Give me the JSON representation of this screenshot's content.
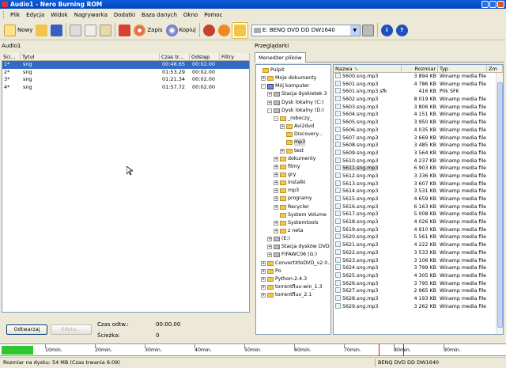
{
  "window": {
    "title": "Audio1 - Nero Burning ROM"
  },
  "menu": [
    "Plik",
    "Edycja",
    "Widok",
    "Nagrywarka",
    "Dodatki",
    "Baza danych",
    "Okno",
    "Pomoc"
  ],
  "toolbar": {
    "new_label": "Nowy",
    "burn_label": "Zapis",
    "copy_label": "Kopiuj",
    "drive_label": "E: BENQ DVD DD DW1640"
  },
  "left": {
    "title": "Audio1",
    "columns": [
      "Ści...",
      "Tytuł",
      "Czas tr...",
      "Odstęp",
      "Filtry"
    ],
    "tracks": [
      {
        "num": "1*",
        "title": "sng",
        "time": "00:48.65",
        "gap": "00:02.00"
      },
      {
        "num": "2*",
        "title": "sng",
        "time": "01:53.29",
        "gap": "00:02.00"
      },
      {
        "num": "3*",
        "title": "sng",
        "time": "01:21.34",
        "gap": "00:02.00"
      },
      {
        "num": "4*",
        "title": "sng",
        "time": "01:57.72",
        "gap": "00:02.00"
      }
    ],
    "play_label": "Odtwarzaj",
    "edit_label": "Edytu...",
    "play_time_label": "Czas odtw.:",
    "play_time_value": "00:00.00",
    "track_label": "Ścieżka:",
    "track_value": "0"
  },
  "right": {
    "title": "Przeglądarki",
    "tab": "Menedżer plików",
    "tree": [
      {
        "label": "Pulpit",
        "icon": "folder",
        "sign": ""
      },
      {
        "label": "Moje dokumenty",
        "icon": "folder",
        "sign": "+"
      },
      {
        "label": "Mój komputer",
        "icon": "computer",
        "sign": "-"
      },
      {
        "label": "Stacja dyskietek 3",
        "icon": "drive",
        "sign": "+"
      },
      {
        "label": "Dysk lokalny (C:)",
        "icon": "drive",
        "sign": "+"
      },
      {
        "label": "Dysk lokalny (D:)",
        "icon": "drive",
        "sign": "-"
      },
      {
        "label": "_roboczy_",
        "icon": "folder",
        "sign": "-"
      },
      {
        "label": "Avi2dvd",
        "icon": "folder",
        "sign": "+"
      },
      {
        "label": "Discovery...",
        "icon": "folder",
        "sign": ""
      },
      {
        "label": "mp3",
        "icon": "folder",
        "sign": ""
      },
      {
        "label": "test",
        "icon": "folder",
        "sign": "+"
      },
      {
        "label": "dokumenty",
        "icon": "folder",
        "sign": "+"
      },
      {
        "label": "filmy",
        "icon": "folder",
        "sign": "+"
      },
      {
        "label": "gry",
        "icon": "folder",
        "sign": "+"
      },
      {
        "label": "instalki",
        "icon": "folder",
        "sign": "+"
      },
      {
        "label": "mp3",
        "icon": "folder",
        "sign": "+"
      },
      {
        "label": "programy",
        "icon": "folder",
        "sign": "+"
      },
      {
        "label": "Recycler",
        "icon": "folder",
        "sign": "+"
      },
      {
        "label": "System Volume",
        "icon": "folder",
        "sign": ""
      },
      {
        "label": "Systemtools",
        "icon": "folder",
        "sign": "+"
      },
      {
        "label": "z neta",
        "icon": "folder",
        "sign": "+"
      },
      {
        "label": "(E:)",
        "icon": "drive",
        "sign": "+"
      },
      {
        "label": "Stacja dysków DVD",
        "icon": "drive",
        "sign": "+"
      },
      {
        "label": "FIFAWC06 (G:)",
        "icon": "drive",
        "sign": "+"
      },
      {
        "label": "ConvertXtoDVD_v2.0..",
        "icon": "folder",
        "sign": "+"
      },
      {
        "label": "Po",
        "icon": "folder",
        "sign": "+"
      },
      {
        "label": "Python-2.4.3",
        "icon": "folder",
        "sign": "+"
      },
      {
        "label": "torrentflux-win_1.3",
        "icon": "folder",
        "sign": "+"
      },
      {
        "label": "torrentflux_2.1",
        "icon": "folder",
        "sign": "+"
      }
    ],
    "file_columns": [
      "Nazwa",
      "Rozmiar",
      "Typ",
      "Zm"
    ],
    "files": [
      {
        "n": "5600.sng.mp3",
        "s": "3 894 KB",
        "t": "Winamp media file"
      },
      {
        "n": "5601.sng.mp3",
        "s": "4 786 KB",
        "t": "Winamp media file"
      },
      {
        "n": "5601.sng.mp3.sfk",
        "s": "416 KB",
        "t": "Plik SFK"
      },
      {
        "n": "5602.sng.mp3",
        "s": "8 019 KB",
        "t": "Winamp media file"
      },
      {
        "n": "5603.sng.mp3",
        "s": "3 806 KB",
        "t": "Winamp media file"
      },
      {
        "n": "5604.sng.mp3",
        "s": "4 151 KB",
        "t": "Winamp media file"
      },
      {
        "n": "5605.sng.mp3",
        "s": "3 950 KB",
        "t": "Winamp media file"
      },
      {
        "n": "5606.sng.mp3",
        "s": "4 035 KB",
        "t": "Winamp media file"
      },
      {
        "n": "5607.sng.mp3",
        "s": "3 669 KB",
        "t": "Winamp media file"
      },
      {
        "n": "5608.sng.mp3",
        "s": "3 485 KB",
        "t": "Winamp media file"
      },
      {
        "n": "5609.sng.mp3",
        "s": "3 564 KB",
        "t": "Winamp media file"
      },
      {
        "n": "5610.sng.mp3",
        "s": "4 237 KB",
        "t": "Winamp media file"
      },
      {
        "n": "5611.sng.mp3",
        "s": "6 903 KB",
        "t": "Winamp media file"
      },
      {
        "n": "5612.sng.mp3",
        "s": "3 336 KB",
        "t": "Winamp media file"
      },
      {
        "n": "5613.sng.mp3",
        "s": "3 607 KB",
        "t": "Winamp media file"
      },
      {
        "n": "5614.sng.mp3",
        "s": "3 531 KB",
        "t": "Winamp media file"
      },
      {
        "n": "5615.sng.mp3",
        "s": "4 659 KB",
        "t": "Winamp media file"
      },
      {
        "n": "5616.sng.mp3",
        "s": "6 163 KB",
        "t": "Winamp media file"
      },
      {
        "n": "5617.sng.mp3",
        "s": "5 008 KB",
        "t": "Winamp media file"
      },
      {
        "n": "5618.sng.mp3",
        "s": "4 026 KB",
        "t": "Winamp media file"
      },
      {
        "n": "5619.sng.mp3",
        "s": "4 910 KB",
        "t": "Winamp media file"
      },
      {
        "n": "5620.sng.mp3",
        "s": "5 561 KB",
        "t": "Winamp media file"
      },
      {
        "n": "5621.sng.mp3",
        "s": "4 222 KB",
        "t": "Winamp media file"
      },
      {
        "n": "5622.sng.mp3",
        "s": "3 533 KB",
        "t": "Winamp media file"
      },
      {
        "n": "5623.sng.mp3",
        "s": "3 106 KB",
        "t": "Winamp media file"
      },
      {
        "n": "5624.sng.mp3",
        "s": "3 799 KB",
        "t": "Winamp media file"
      },
      {
        "n": "5625.sng.mp3",
        "s": "4 305 KB",
        "t": "Winamp media file"
      },
      {
        "n": "5626.sng.mp3",
        "s": "3 795 KB",
        "t": "Winamp media file"
      },
      {
        "n": "5627.sng.mp3",
        "s": "2 965 KB",
        "t": "Winamp media file"
      },
      {
        "n": "5628.sng.mp3",
        "s": "4 193 KB",
        "t": "Winamp media file"
      },
      {
        "n": "5629.sng.mp3",
        "s": "3 262 KB",
        "t": "Winamp media file"
      }
    ]
  },
  "ruler": {
    "marks": [
      "10min.",
      "20min.",
      "30min.",
      "40min.",
      "50min.",
      "60min.",
      "70min.",
      "80min.",
      "90min."
    ],
    "fill_fraction": 0.065
  },
  "status": {
    "text": "Rozmiar na dysku: 54 MB (Czas trwania 6:09)",
    "device": "BENQ    DVD DD DW1640"
  },
  "colors": {
    "title_blue": "#0a5ed8",
    "selection": "#316ac5",
    "progress_green": "#2fc72f"
  }
}
